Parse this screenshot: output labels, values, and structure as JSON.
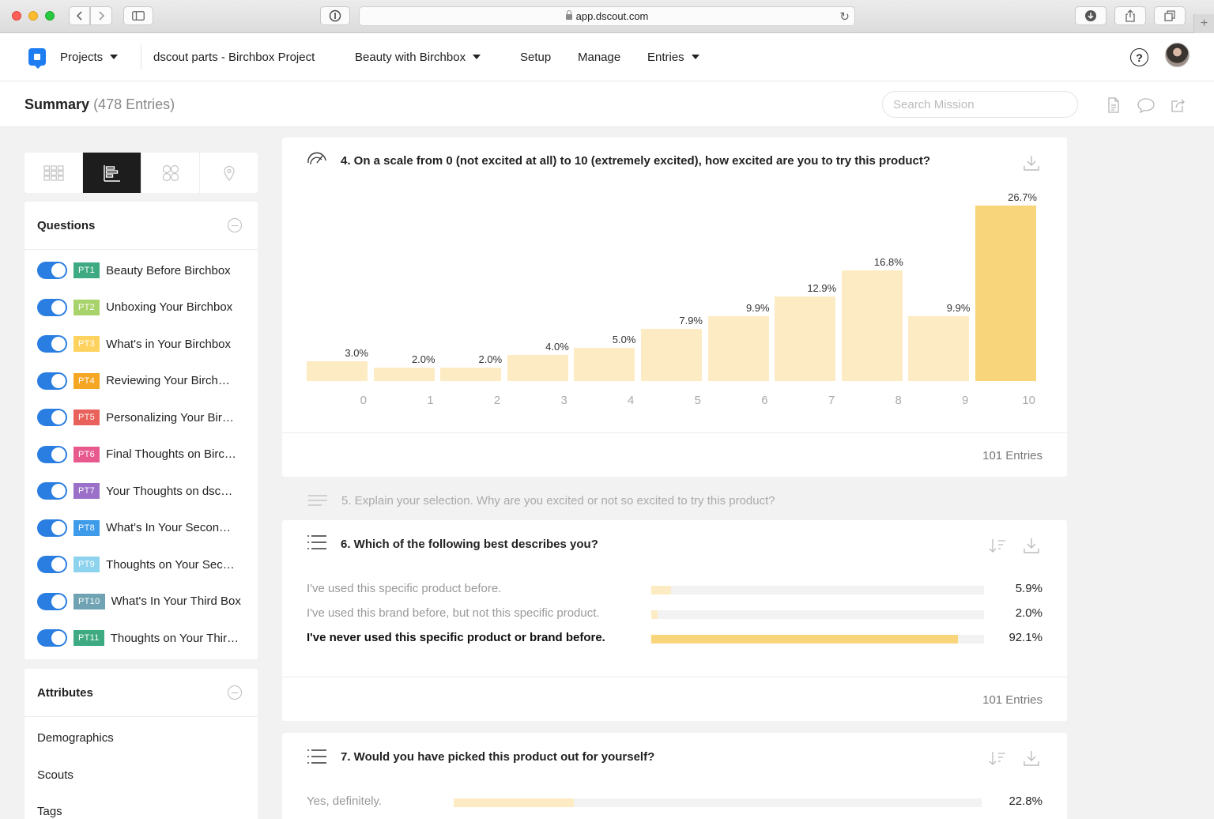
{
  "browser": {
    "url": "app.dscout.com"
  },
  "nav": {
    "projects_label": "Projects",
    "project_name": "dscout parts - Birchbox Project",
    "mission_label": "Beauty with Birchbox",
    "setup_label": "Setup",
    "manage_label": "Manage",
    "entries_label": "Entries",
    "help_label": "?"
  },
  "summary": {
    "title": "Summary",
    "count": "(478 Entries)",
    "search_placeholder": "Search Mission"
  },
  "sidebar": {
    "questions_title": "Questions",
    "questions": [
      {
        "tag": "PT1",
        "label": "Beauty Before Birchbox",
        "color": "#3daa82"
      },
      {
        "tag": "PT2",
        "label": "Unboxing Your Birchbox",
        "color": "#a8d26a"
      },
      {
        "tag": "PT3",
        "label": "What's in Your Birchbox",
        "color": "#fdd25e"
      },
      {
        "tag": "PT4",
        "label": "Reviewing Your Birchbox",
        "color": "#f5a623"
      },
      {
        "tag": "PT5",
        "label": "Personalizing Your Birchbox",
        "color": "#e8615b"
      },
      {
        "tag": "PT6",
        "label": "Final Thoughts on Birchbox",
        "color": "#e85a8e"
      },
      {
        "tag": "PT7",
        "label": "Your Thoughts on dscout",
        "color": "#9b70c9"
      },
      {
        "tag": "PT8",
        "label": "What's In Your Second Box",
        "color": "#3d9be9"
      },
      {
        "tag": "PT9",
        "label": "Thoughts on Your Second Box",
        "color": "#8ed3ee"
      },
      {
        "tag": "PT10",
        "label": "What's In Your Third Box",
        "color": "#6fa3b3"
      },
      {
        "tag": "PT11",
        "label": "Thoughts on Your Third Box",
        "color": "#3daa82"
      }
    ],
    "attributes_title": "Attributes",
    "attributes": [
      "Demographics",
      "Scouts",
      "Tags"
    ]
  },
  "q4": {
    "title": "4. On a scale from 0 (not excited at all) to 10 (extremely excited), how excited are you to try this product?",
    "entries": "101 Entries"
  },
  "chart_data": {
    "type": "bar",
    "categories": [
      "0",
      "1",
      "2",
      "3",
      "4",
      "5",
      "6",
      "7",
      "8",
      "9",
      "10"
    ],
    "values": [
      3.0,
      2.0,
      2.0,
      4.0,
      5.0,
      7.9,
      9.9,
      12.9,
      16.8,
      9.9,
      26.7
    ],
    "labels": [
      "3.0%",
      "2.0%",
      "2.0%",
      "4.0%",
      "5.0%",
      "7.9%",
      "9.9%",
      "12.9%",
      "16.8%",
      "9.9%",
      "26.7%"
    ],
    "highlight_index": 10,
    "colors": {
      "bar": "#fdebc3",
      "highlight": "#f8d57b"
    },
    "ylim": [
      0,
      26.7
    ]
  },
  "q5": {
    "title": "5. Explain your selection. Why are you excited or not so excited to try this product?"
  },
  "q6": {
    "title": "6. Which of the following best describes you?",
    "options": [
      {
        "label": "I've used this specific product before.",
        "value": 5.9,
        "pct": "5.9%",
        "top": false
      },
      {
        "label": "I've used this brand before, but not this specific product.",
        "value": 2.0,
        "pct": "2.0%",
        "top": false
      },
      {
        "label": "I've never used this specific product or brand before.",
        "value": 92.1,
        "pct": "92.1%",
        "top": true
      }
    ],
    "entries": "101 Entries"
  },
  "q7": {
    "title": "7. Would you have picked this product out for yourself?",
    "options": [
      {
        "label": "Yes, definitely.",
        "value": 22.8,
        "pct": "22.8%",
        "top": false
      }
    ]
  },
  "colors": {
    "accent": "#2a7de1",
    "bar_light": "#fdebc3",
    "bar_strong": "#f8d57b"
  }
}
